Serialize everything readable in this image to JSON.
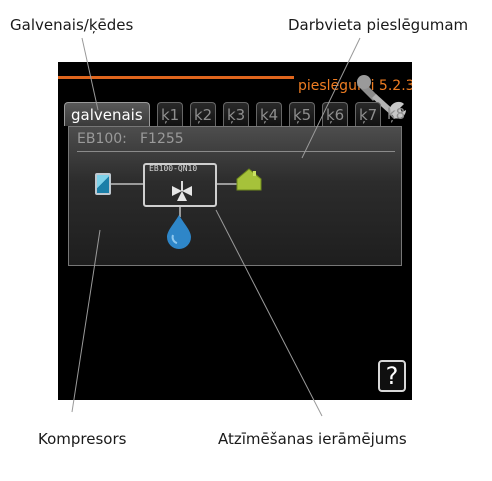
{
  "callouts": {
    "main_chains": "Galvenais/ķēdes",
    "connection_workplace": "Darbvieta pieslēgumam",
    "compressor": "Kompresors",
    "marking_frame": "Atzīmēšanas ierāmējums"
  },
  "screen": {
    "menu_title": "pieslēgumi 5.2.3",
    "tabs": [
      "galvenais",
      "ķ1",
      "ķ2",
      "ķ3",
      "ķ4",
      "ķ5",
      "ķ6",
      "ķ7",
      "ķ8"
    ],
    "active_tab": "galvenais",
    "panel": {
      "unit_code": "EB100:",
      "unit_model": "F1255",
      "valve_label": "EB100-QN10"
    },
    "help_symbol": "?",
    "icons": [
      "wrench-icon",
      "compressor-icon",
      "valve-icon",
      "house-icon",
      "water-drop-icon",
      "help-icon"
    ],
    "colors": {
      "accent_orange": "#e0661d",
      "title_orange": "#ef7d22",
      "house_green": "#a6c23a",
      "water_blue": "#2e86c8",
      "compressor_blue": "#1b7fa8"
    }
  }
}
